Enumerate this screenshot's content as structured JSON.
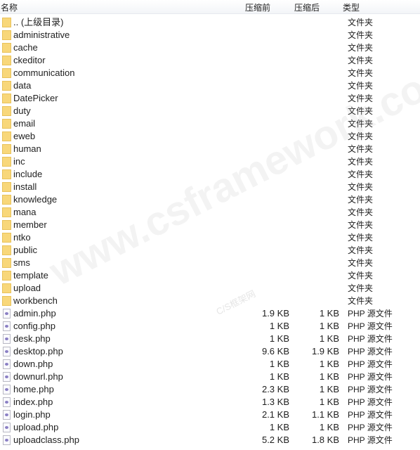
{
  "header": {
    "name": "名称",
    "before": "压缩前",
    "after": "压缩后",
    "type": "类型"
  },
  "watermark": {
    "main": "www.csframework.com",
    "sub": "C/S框架网"
  },
  "files": [
    {
      "name": ".. (上级目录)",
      "before": "",
      "after": "",
      "type": "文件夹",
      "icon": "folder-icon"
    },
    {
      "name": "administrative",
      "before": "",
      "after": "",
      "type": "文件夹",
      "icon": "folder-icon"
    },
    {
      "name": "cache",
      "before": "",
      "after": "",
      "type": "文件夹",
      "icon": "folder-icon"
    },
    {
      "name": "ckeditor",
      "before": "",
      "after": "",
      "type": "文件夹",
      "icon": "folder-icon"
    },
    {
      "name": "communication",
      "before": "",
      "after": "",
      "type": "文件夹",
      "icon": "folder-icon"
    },
    {
      "name": "data",
      "before": "",
      "after": "",
      "type": "文件夹",
      "icon": "folder-icon"
    },
    {
      "name": "DatePicker",
      "before": "",
      "after": "",
      "type": "文件夹",
      "icon": "folder-icon"
    },
    {
      "name": "duty",
      "before": "",
      "after": "",
      "type": "文件夹",
      "icon": "folder-icon"
    },
    {
      "name": "email",
      "before": "",
      "after": "",
      "type": "文件夹",
      "icon": "folder-icon"
    },
    {
      "name": "eweb",
      "before": "",
      "after": "",
      "type": "文件夹",
      "icon": "folder-icon"
    },
    {
      "name": "human",
      "before": "",
      "after": "",
      "type": "文件夹",
      "icon": "folder-icon"
    },
    {
      "name": "inc",
      "before": "",
      "after": "",
      "type": "文件夹",
      "icon": "folder-icon"
    },
    {
      "name": "include",
      "before": "",
      "after": "",
      "type": "文件夹",
      "icon": "folder-icon"
    },
    {
      "name": "install",
      "before": "",
      "after": "",
      "type": "文件夹",
      "icon": "folder-icon"
    },
    {
      "name": "knowledge",
      "before": "",
      "after": "",
      "type": "文件夹",
      "icon": "folder-icon"
    },
    {
      "name": "mana",
      "before": "",
      "after": "",
      "type": "文件夹",
      "icon": "folder-icon"
    },
    {
      "name": "member",
      "before": "",
      "after": "",
      "type": "文件夹",
      "icon": "folder-icon"
    },
    {
      "name": "ntko",
      "before": "",
      "after": "",
      "type": "文件夹",
      "icon": "folder-icon"
    },
    {
      "name": "public",
      "before": "",
      "after": "",
      "type": "文件夹",
      "icon": "folder-icon"
    },
    {
      "name": "sms",
      "before": "",
      "after": "",
      "type": "文件夹",
      "icon": "folder-icon"
    },
    {
      "name": "template",
      "before": "",
      "after": "",
      "type": "文件夹",
      "icon": "folder-icon"
    },
    {
      "name": "upload",
      "before": "",
      "after": "",
      "type": "文件夹",
      "icon": "folder-icon"
    },
    {
      "name": "workbench",
      "before": "",
      "after": "",
      "type": "文件夹",
      "icon": "folder-icon"
    },
    {
      "name": "admin.php",
      "before": "1.9 KB",
      "after": "1 KB",
      "type": "PHP 源文件",
      "icon": "php-file-icon"
    },
    {
      "name": "config.php",
      "before": "1 KB",
      "after": "1 KB",
      "type": "PHP 源文件",
      "icon": "php-file-icon"
    },
    {
      "name": "desk.php",
      "before": "1 KB",
      "after": "1 KB",
      "type": "PHP 源文件",
      "icon": "php-file-icon"
    },
    {
      "name": "desktop.php",
      "before": "9.6 KB",
      "after": "1.9 KB",
      "type": "PHP 源文件",
      "icon": "php-file-icon"
    },
    {
      "name": "down.php",
      "before": "1 KB",
      "after": "1 KB",
      "type": "PHP 源文件",
      "icon": "php-file-icon"
    },
    {
      "name": "downurl.php",
      "before": "1 KB",
      "after": "1 KB",
      "type": "PHP 源文件",
      "icon": "php-file-icon"
    },
    {
      "name": "home.php",
      "before": "2.3 KB",
      "after": "1 KB",
      "type": "PHP 源文件",
      "icon": "php-file-icon"
    },
    {
      "name": "index.php",
      "before": "1.3 KB",
      "after": "1 KB",
      "type": "PHP 源文件",
      "icon": "php-file-icon"
    },
    {
      "name": "login.php",
      "before": "2.1 KB",
      "after": "1.1 KB",
      "type": "PHP 源文件",
      "icon": "php-file-icon"
    },
    {
      "name": "upload.php",
      "before": "1 KB",
      "after": "1 KB",
      "type": "PHP 源文件",
      "icon": "php-file-icon"
    },
    {
      "name": "uploadclass.php",
      "before": "5.2 KB",
      "after": "1.8 KB",
      "type": "PHP 源文件",
      "icon": "php-file-icon"
    }
  ]
}
